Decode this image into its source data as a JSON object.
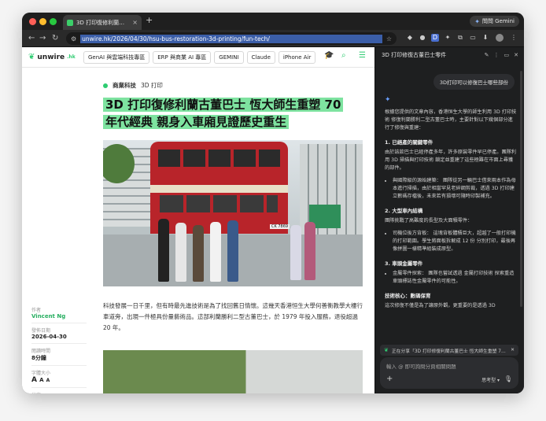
{
  "browser": {
    "tab_title": "3D 打印復修利蘭古董巴士 恆大...",
    "tab_close": "×",
    "new_tab": "+",
    "gemini_button": "問問 Gemini",
    "url": "unwire.hk/2026/04/30/hsu-bus-restoration-3d-printing/fun-tech/"
  },
  "site": {
    "logo_text": "unwire",
    "logo_suffix": ".hk",
    "nav": [
      "GenAI 與雲端科技專區",
      "ERP 與商業 AI 專區",
      "GEMINI",
      "Claude",
      "iPhone Air"
    ]
  },
  "article": {
    "category": "商業科技",
    "subcategory": "3D 打印",
    "headline_line1": "3D 打印復修利蘭古董巴士 恆大師生重塑 70",
    "headline_line2": "年代經典 親身入車廂見證歷史重生",
    "paragraph": "科技發展一日千里，但有時最先進技術是為了找回舊日情懷。這幾天香港恒生大學何善衡教學大樓行車道旁，出現一件極具份量藝術品。這部利蘭勝利二型古董巴士，於 1979 年投入服務，退役超過 20 年。",
    "bus_plate": "CK 7869"
  },
  "meta": {
    "author_label": "作者",
    "author": "Vincent Ng",
    "date_label": "發佈日期",
    "date": "2026-04-30",
    "read_label": "閱讀時間",
    "read": "8分鐘",
    "font_label": "字體大小",
    "share_label": "分享"
  },
  "panel": {
    "title": "3D 打印修復古董巴士零件",
    "user_question": "3D打印可以修復巴士哪些部份",
    "intro": "根據您提供的文章內容，香港恒生大學的師生利用 3D 打印技術 修復利蘭勝利二型古董巴士時，主要針對以下幾個部分進行了修復與重建：",
    "s1_title": "1. 已絕產的關鍵零件",
    "s1_body": "由於該款巴士已經停產多年，許多原裝零件早已停產。團隊利用 3D 掃描與打印技術 鎖定並重建了這些極難在市面上尋獲的部件。",
    "s1_bullet": "與國際級的源始建築： 團隊從另一輛巴士借來兩本作為母本進行掃描，由於相當罕見老碎鋼剪裁，透過 3D 打印建立數碼存檔後，未來若有損壞可隨時印製補充。",
    "s2_title": "2. 大型車內結構",
    "s2_body": "團隊挑戰了高難度的長型及大面積零件：",
    "s2_bullet": "司機位後方背板： 這塊背板體積巨大，超越了一般打印機的打印範圍。學生將面板拆解成 12 份 分別打印，最後再像拼圖一樣精準組裝成原型。",
    "s3_title": "3. 車頭金屬零件",
    "s3_bullet": "金屬零件探索： 團隊也嘗試透過 金屬打印技術 探索重造車頭標誌性金屬零件的可能性。",
    "s4_title": "技術核心：數碼保育",
    "s4_body": "這次修復不僅是為了讓原外觀，更重要的是透過 3D",
    "share_text": "正在分享「3D 打印修復利蘭古董巴士 恆大師生重塑 70...",
    "input_placeholder": "輸入 @ 即可詢問分頁相關問題",
    "mode": "思考型"
  }
}
